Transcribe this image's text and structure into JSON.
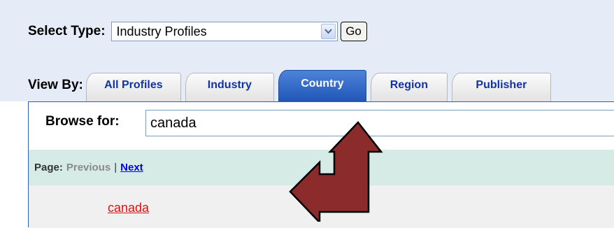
{
  "select_type": {
    "label": "Select Type:",
    "value": "Industry Profiles",
    "go_label": "Go"
  },
  "view_by": {
    "label": "View By:",
    "tabs": [
      {
        "label": "All Profiles",
        "active": false
      },
      {
        "label": "Industry",
        "active": false
      },
      {
        "label": "Country",
        "active": true
      },
      {
        "label": "Region",
        "active": false
      },
      {
        "label": "Publisher",
        "active": false
      }
    ]
  },
  "browse": {
    "label": "Browse for:",
    "value": "canada"
  },
  "pagination": {
    "label": "Page:",
    "previous": "Previous",
    "separator": "|",
    "next": "Next"
  },
  "results": [
    {
      "label": "canada"
    }
  ],
  "annotation": {
    "arrow_color": "#8b2b2b",
    "icon": "bent-double-arrow-icon"
  }
}
